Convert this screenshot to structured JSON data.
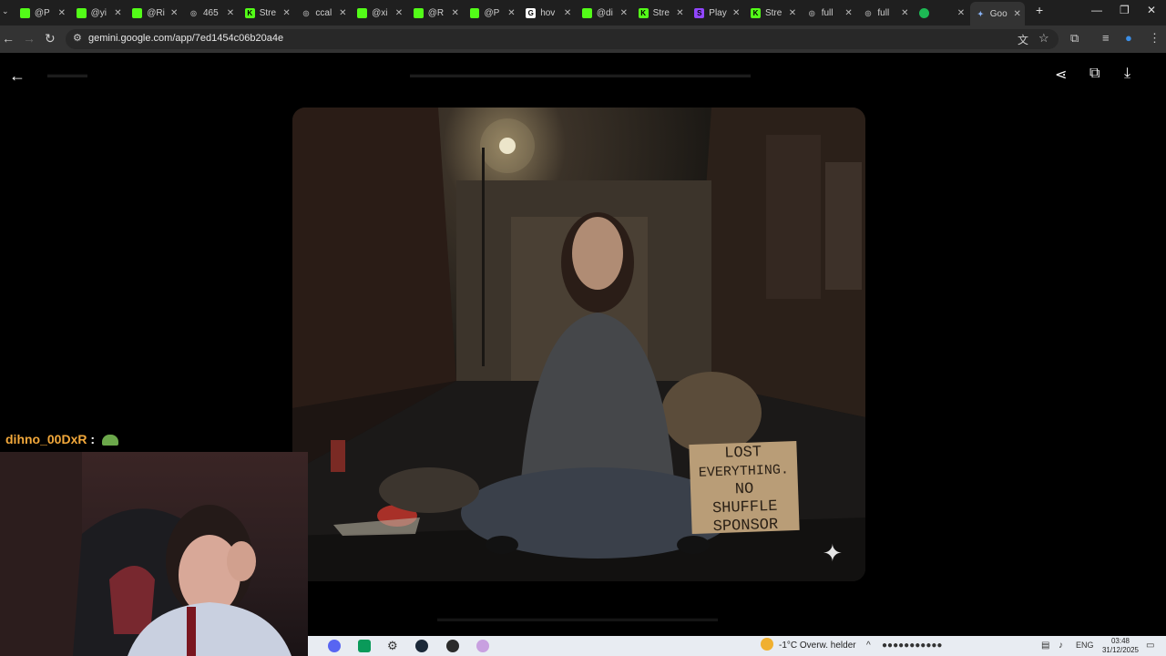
{
  "browser": {
    "tabs": [
      {
        "title": "@P",
        "favicon": "green-square-icon",
        "active": false
      },
      {
        "title": "@yi",
        "favicon": "green-square-icon",
        "active": false
      },
      {
        "title": "@Ri",
        "favicon": "green-square-icon",
        "active": false
      },
      {
        "title": "465",
        "favicon": "globe-icon",
        "active": false
      },
      {
        "title": "Stre",
        "favicon": "kick-icon",
        "active": false
      },
      {
        "title": "ccal",
        "favicon": "globe-icon",
        "active": false
      },
      {
        "title": "@xi",
        "favicon": "green-square-icon",
        "active": false
      },
      {
        "title": "@R",
        "favicon": "green-square-icon",
        "active": false
      },
      {
        "title": "@P",
        "favicon": "green-square-icon",
        "active": false
      },
      {
        "title": "hov",
        "favicon": "google-icon",
        "active": false
      },
      {
        "title": "@di",
        "favicon": "green-square-icon",
        "active": false
      },
      {
        "title": "Stre",
        "favicon": "kick-icon",
        "active": false
      },
      {
        "title": "Play",
        "favicon": "purple-s-icon",
        "active": false
      },
      {
        "title": "Stre",
        "favicon": "kick-icon",
        "active": false
      },
      {
        "title": "full",
        "favicon": "globe-icon",
        "active": false
      },
      {
        "title": "full",
        "favicon": "globe-icon",
        "active": false
      },
      {
        "title": "",
        "favicon": "spotify-icon",
        "active": false
      },
      {
        "title": "Goo",
        "favicon": "gemini-icon",
        "active": true
      }
    ],
    "new_tab": "+",
    "minimize": "—",
    "restore": "❐",
    "close": "✕",
    "url": "gemini.google.com/app/7ed1454c06b20a4e"
  },
  "viewer": {
    "sign_lines": [
      "LOST",
      "EVERYTHING.",
      "NO",
      "SHUFFLE",
      "SPONSOR"
    ]
  },
  "chat": {
    "username": "dihno_00DxR",
    "separator": ":"
  },
  "taskbar": {
    "weather": "-1°C  Overw. helder",
    "language": "ENG",
    "time": "03:48",
    "date": "31/12/2025"
  },
  "colors": {
    "accent_kick": "#53fc18",
    "chat_name": "#f2a83b",
    "tab_bg": "#1f1f1f",
    "addr_bg": "#333333"
  }
}
